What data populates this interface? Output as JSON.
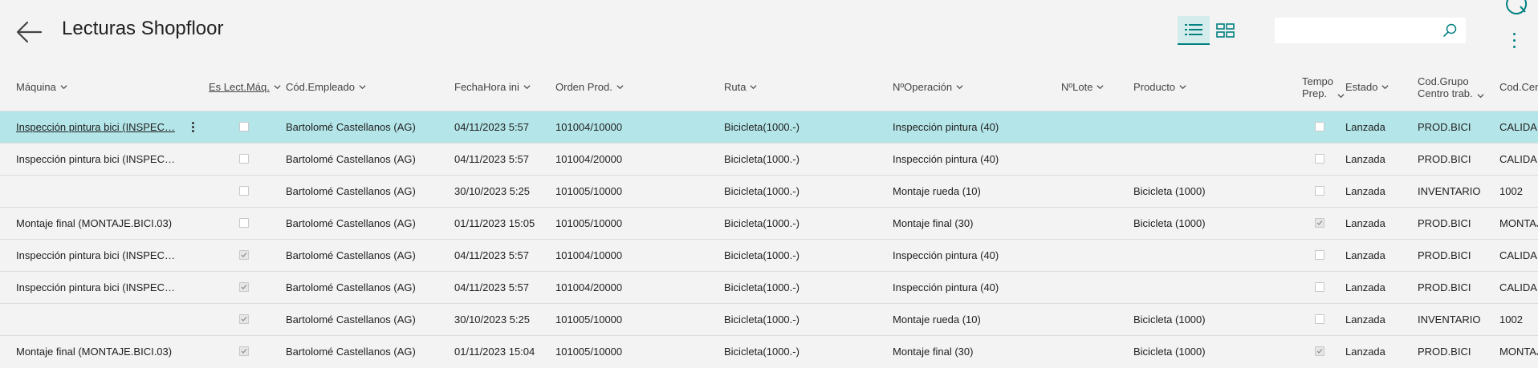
{
  "page": {
    "title": "Lecturas Shopfloor"
  },
  "toolbar": {
    "search_placeholder": ""
  },
  "columns": {
    "maquina": "Máquina",
    "es_lect": "Es Lect.Máq.",
    "empleado": "Cód.Empleado",
    "fecha": "FechaHora ini",
    "orden": "Orden Prod.",
    "ruta": "Ruta",
    "operacion": "NºOperación",
    "lote": "NºLote",
    "producto": "Producto",
    "tempo_1": "Tempo",
    "tempo_2": "Prep.",
    "estado": "Estado",
    "grupo_1": "Cod.Grupo",
    "grupo_2": "Centro trab.",
    "centro": "Cod.Cent"
  },
  "rows": [
    {
      "maquina": "Inspección pintura bici (INSPEC…",
      "es_lect": false,
      "empleado": "Bartolomé Castellanos  (AG)",
      "fecha": "04/11/2023 5:57",
      "orden": "101004/10000",
      "ruta": "Bicicleta(1000.-)",
      "operacion": "Inspección pintura (40)",
      "lote": "",
      "producto": "",
      "tempo": false,
      "estado": "Lanzada",
      "grupo": "PROD.BICI",
      "centro": "CALIDAD"
    },
    {
      "maquina": "Inspección pintura bici (INSPEC…",
      "es_lect": false,
      "empleado": "Bartolomé Castellanos  (AG)",
      "fecha": "04/11/2023 5:57",
      "orden": "101004/20000",
      "ruta": "Bicicleta(1000.-)",
      "operacion": "Inspección pintura (40)",
      "lote": "",
      "producto": "",
      "tempo": false,
      "estado": "Lanzada",
      "grupo": "PROD.BICI",
      "centro": "CALIDAD"
    },
    {
      "maquina": "",
      "es_lect": false,
      "empleado": "Bartolomé Castellanos  (AG)",
      "fecha": "30/10/2023 5:25",
      "orden": "101005/10000",
      "ruta": "Bicicleta(1000.-)",
      "operacion": "Montaje rueda (10)",
      "lote": "",
      "producto": "Bicicleta (1000)",
      "tempo": false,
      "estado": "Lanzada",
      "grupo": "INVENTARIO",
      "centro": "1002"
    },
    {
      "maquina": "Montaje final (MONTAJE.BICI.03)",
      "es_lect": false,
      "empleado": "Bartolomé Castellanos  (AG)",
      "fecha": "01/11/2023 15:05",
      "orden": "101005/10000",
      "ruta": "Bicicleta(1000.-)",
      "operacion": "Montaje final (30)",
      "lote": "",
      "producto": "Bicicleta (1000)",
      "tempo": true,
      "estado": "Lanzada",
      "grupo": "PROD.BICI",
      "centro": "MONTAJE"
    },
    {
      "maquina": "Inspección pintura bici (INSPEC…",
      "es_lect": true,
      "empleado": "Bartolomé Castellanos  (AG)",
      "fecha": "04/11/2023 5:57",
      "orden": "101004/10000",
      "ruta": "Bicicleta(1000.-)",
      "operacion": "Inspección pintura (40)",
      "lote": "",
      "producto": "",
      "tempo": false,
      "estado": "Lanzada",
      "grupo": "PROD.BICI",
      "centro": "CALIDAD"
    },
    {
      "maquina": "Inspección pintura bici (INSPEC…",
      "es_lect": true,
      "empleado": "Bartolomé Castellanos  (AG)",
      "fecha": "04/11/2023 5:57",
      "orden": "101004/20000",
      "ruta": "Bicicleta(1000.-)",
      "operacion": "Inspección pintura (40)",
      "lote": "",
      "producto": "",
      "tempo": false,
      "estado": "Lanzada",
      "grupo": "PROD.BICI",
      "centro": "CALIDAD"
    },
    {
      "maquina": "",
      "es_lect": true,
      "empleado": "Bartolomé Castellanos  (AG)",
      "fecha": "30/10/2023 5:25",
      "orden": "101005/10000",
      "ruta": "Bicicleta(1000.-)",
      "operacion": "Montaje rueda (10)",
      "lote": "",
      "producto": "Bicicleta (1000)",
      "tempo": false,
      "estado": "Lanzada",
      "grupo": "INVENTARIO",
      "centro": "1002"
    },
    {
      "maquina": "Montaje final (MONTAJE.BICI.03)",
      "es_lect": true,
      "empleado": "Bartolomé Castellanos  (AG)",
      "fecha": "01/11/2023 15:04",
      "orden": "101005/10000",
      "ruta": "Bicicleta(1000.-)",
      "operacion": "Montaje final (30)",
      "lote": "",
      "producto": "Bicicleta (1000)",
      "tempo": true,
      "estado": "Lanzada",
      "grupo": "PROD.BICI",
      "centro": "MONTAJE"
    }
  ],
  "selected_row": 0,
  "theme": {
    "accent": "#00807f",
    "selected_row_bg": "#b4e6e9",
    "background": "#f3f3f3"
  },
  "icons": {
    "back": "arrow-left-icon",
    "list_view": "list-view-icon",
    "tile_view": "tile-view-icon",
    "search": "search-icon",
    "refresh": "refresh-icon",
    "more": "more-vertical-icon",
    "sort": "chevron-down-icon"
  }
}
